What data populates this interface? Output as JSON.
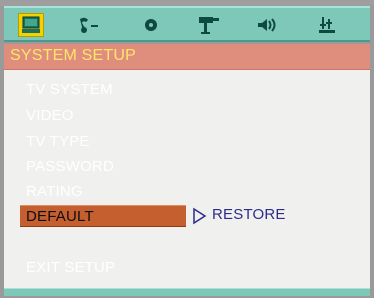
{
  "icons": [
    {
      "name": "general-setup-icon",
      "selected": true
    },
    {
      "name": "audio-setup-icon",
      "selected": false
    },
    {
      "name": "dolby-setup-icon",
      "selected": false
    },
    {
      "name": "video-setup-icon",
      "selected": false
    },
    {
      "name": "speaker-setup-icon",
      "selected": false
    },
    {
      "name": "preference-setup-icon",
      "selected": false
    }
  ],
  "header": {
    "title": "SYSTEM SETUP"
  },
  "menu": {
    "items": [
      "TV SYSTEM",
      "VIDEO",
      "TV TYPE",
      "PASSWORD",
      "RATING",
      "DEFAULT",
      "EXIT SETUP"
    ],
    "active_index": 5
  },
  "submenu": {
    "option": "RESTORE"
  },
  "colors": {
    "icon_bar": "#7dc8b8",
    "title_bar": "#df8d7d",
    "title_text": "#ffe66b",
    "menu_bg": "#f0f0ef",
    "highlight": "#c65f30",
    "option_text": "#2e2c8a"
  }
}
